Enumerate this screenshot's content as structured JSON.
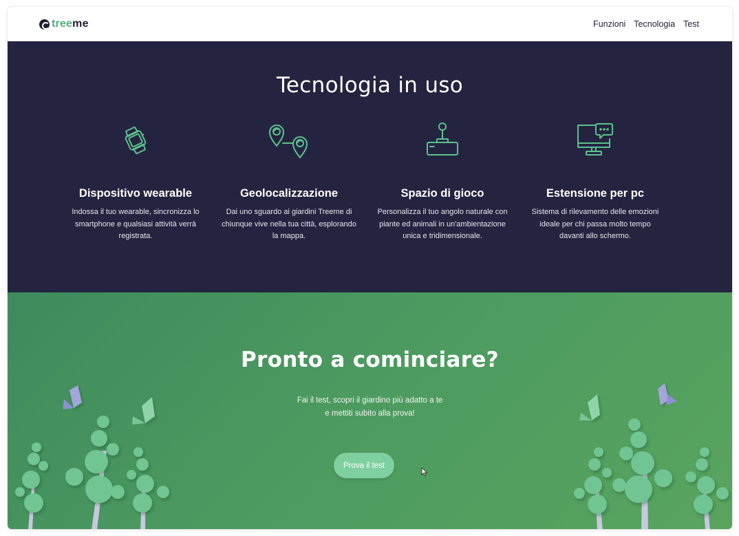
{
  "header": {
    "logo": {
      "prefix": "tree",
      "suffix": "me"
    },
    "nav": [
      "Funzioni",
      "Tecnologia",
      "Test"
    ]
  },
  "tech": {
    "title": "Tecnologia in uso",
    "features": [
      {
        "icon": "smartwatch-icon",
        "title": "Dispositivo wearable",
        "text": "Indossa il tuo wearable, sincronizza lo smartphone e qualsiasi attività verrà registrata."
      },
      {
        "icon": "map-pins-icon",
        "title": "Geolocalizzazione",
        "text": "Dai uno sguardo ai giardini Treeme di chiunque vive nella tua città, esplorando la mappa."
      },
      {
        "icon": "joystick-icon",
        "title": "Spazio di gioco",
        "text": "Personalizza il tuo angolo naturale con piante ed animali in un'ambientazione unica e tridimensionale."
      },
      {
        "icon": "monitor-chat-icon",
        "title": "Estensione per pc",
        "text": "Sistema di rilevamento delle emozioni ideale per chi passa molto tempo davanti allo schermo."
      }
    ]
  },
  "cta": {
    "title": "Pronto a cominciare?",
    "subtitle_line1": "Fai il test, scopri il giardino più adatto a te",
    "subtitle_line2": "e mettiti subito alla prova!",
    "button": "Prova il test"
  },
  "colors": {
    "dark_bg": "#242440",
    "accent_green": "#5cc28c",
    "cta_start": "#3f8a5d",
    "cta_end": "#59a45f",
    "button": "#7fd0a0"
  }
}
